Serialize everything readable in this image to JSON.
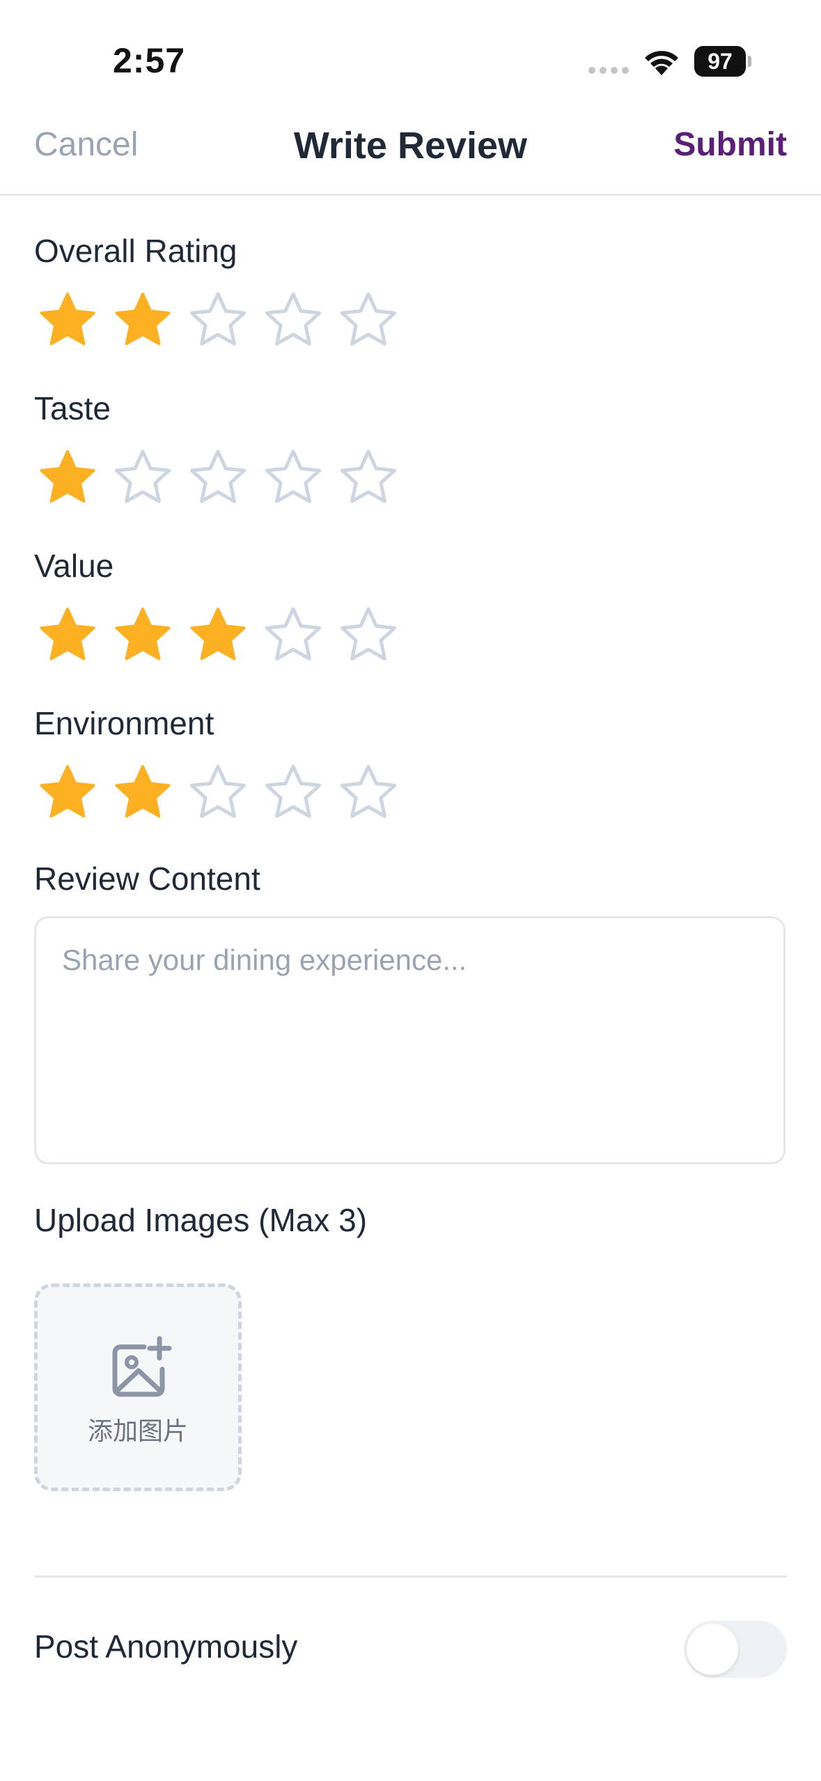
{
  "status_bar": {
    "time": "2:57",
    "battery": "97"
  },
  "nav": {
    "cancel": "Cancel",
    "title": "Write Review",
    "submit": "Submit"
  },
  "ratings": [
    {
      "label": "Overall Rating",
      "value": 2,
      "max": 5
    },
    {
      "label": "Taste",
      "value": 1,
      "max": 5
    },
    {
      "label": "Value",
      "value": 3,
      "max": 5
    },
    {
      "label": "Environment",
      "value": 2,
      "max": 5
    }
  ],
  "review": {
    "label": "Review Content",
    "placeholder": "Share your dining experience...",
    "value": ""
  },
  "upload": {
    "label": "Upload Images (Max 3)",
    "button_text": "添加图片",
    "icon": "image-add-icon"
  },
  "anonymous": {
    "label": "Post Anonymously",
    "enabled": false
  },
  "colors": {
    "star_filled": "#FDB022",
    "star_empty": "#CDD5E0",
    "accent": "#5B1F7A",
    "muted": "#9AA3B2"
  }
}
